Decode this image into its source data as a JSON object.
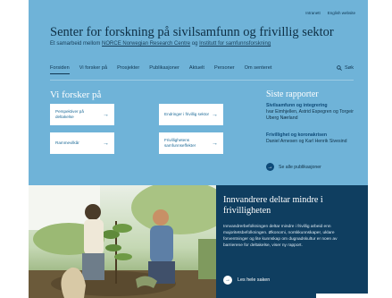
{
  "top_links": [
    "Intranett",
    "English website"
  ],
  "header": {
    "title": "Senter for forskning på sivilsamfunn og frivillig sektor",
    "tagline_prefix": "Et samarbeid mellom",
    "partner_1": "NORCE Norwegian Research Centre",
    "tagline_joiner": "og",
    "partner_2": "Institutt for samfunnsforskning"
  },
  "nav": {
    "items": [
      "Forsiden",
      "Vi forsker på",
      "Prosjekter",
      "Publikasjoner",
      "Aktuelt",
      "Personer",
      "Om senteret"
    ],
    "active": "Forsiden",
    "search_label": "Søk"
  },
  "research": {
    "heading": "Vi forsker på",
    "cards": [
      "Perspektiver på deltakelse",
      "Endringer i frivillig sektor",
      "Rammevilkår",
      "Frivillighetens samfunnseffekter"
    ]
  },
  "reports": {
    "heading": "Siste rapporter",
    "items": [
      {
        "title": "Sivilsamfunn og integrering",
        "authors": "Ivar Eimhjellen, Astrid Espegren og Torgeir Uberg Nærland"
      },
      {
        "title": "Frivillighet og koronakrisen",
        "authors": "Daniel Arnesen og Karl Henrik Sivesind"
      }
    ],
    "see_all": "Se alle publikasjoner"
  },
  "feature": {
    "title": "Innvandrere deltar mindre i frivilligheten",
    "body": "Innvandrerbefolkningen deltar mindre i frivillig arbeid enn majoritetsbefolkningen. Økonomi, norskkunnskaper, uklare forventninger og lite kunnskap om dugnadskultur er noen av barrierene for deltakelse, viser ny rapport.",
    "read_more": "Les hele saken"
  }
}
